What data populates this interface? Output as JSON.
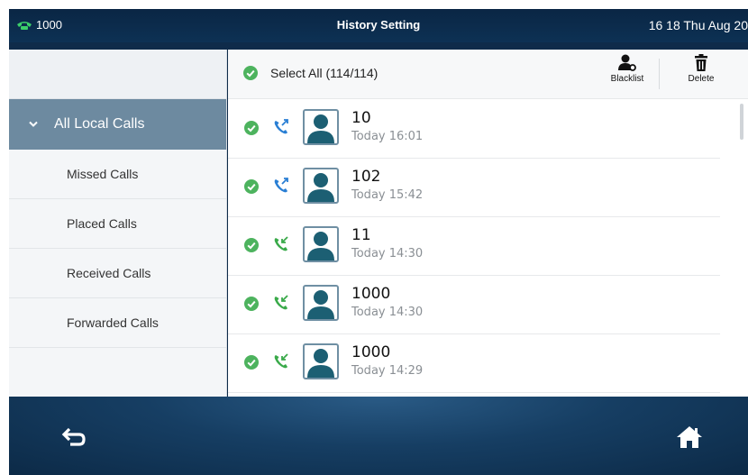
{
  "status_bar": {
    "account": "1000",
    "title": "History Setting",
    "datetime": "16 18 Thu Aug 20"
  },
  "sidebar": {
    "active_item": "All Local Calls",
    "items": [
      {
        "label": "Missed Calls"
      },
      {
        "label": "Placed Calls"
      },
      {
        "label": "Received Calls"
      },
      {
        "label": "Forwarded Calls"
      }
    ]
  },
  "toolbar": {
    "select_all_label": "Select All (114/114)",
    "blacklist_label": "Blacklist",
    "delete_label": "Delete"
  },
  "calls": [
    {
      "number": "10",
      "time": "Today 16:01",
      "direction": "outgoing",
      "selected": true
    },
    {
      "number": "102",
      "time": "Today 15:42",
      "direction": "outgoing",
      "selected": true
    },
    {
      "number": "11",
      "time": "Today 14:30",
      "direction": "incoming",
      "selected": true
    },
    {
      "number": "1000",
      "time": "Today 14:30",
      "direction": "incoming",
      "selected": true
    },
    {
      "number": "1000",
      "time": "Today 14:29",
      "direction": "incoming",
      "selected": true
    }
  ],
  "colors": {
    "check_green": "#4db35e",
    "outgoing_blue": "#2a7fd4",
    "incoming_green": "#3aaa4a",
    "sidebar_active": "#6d8aa0",
    "avatar_teal": "#1c5f73"
  }
}
